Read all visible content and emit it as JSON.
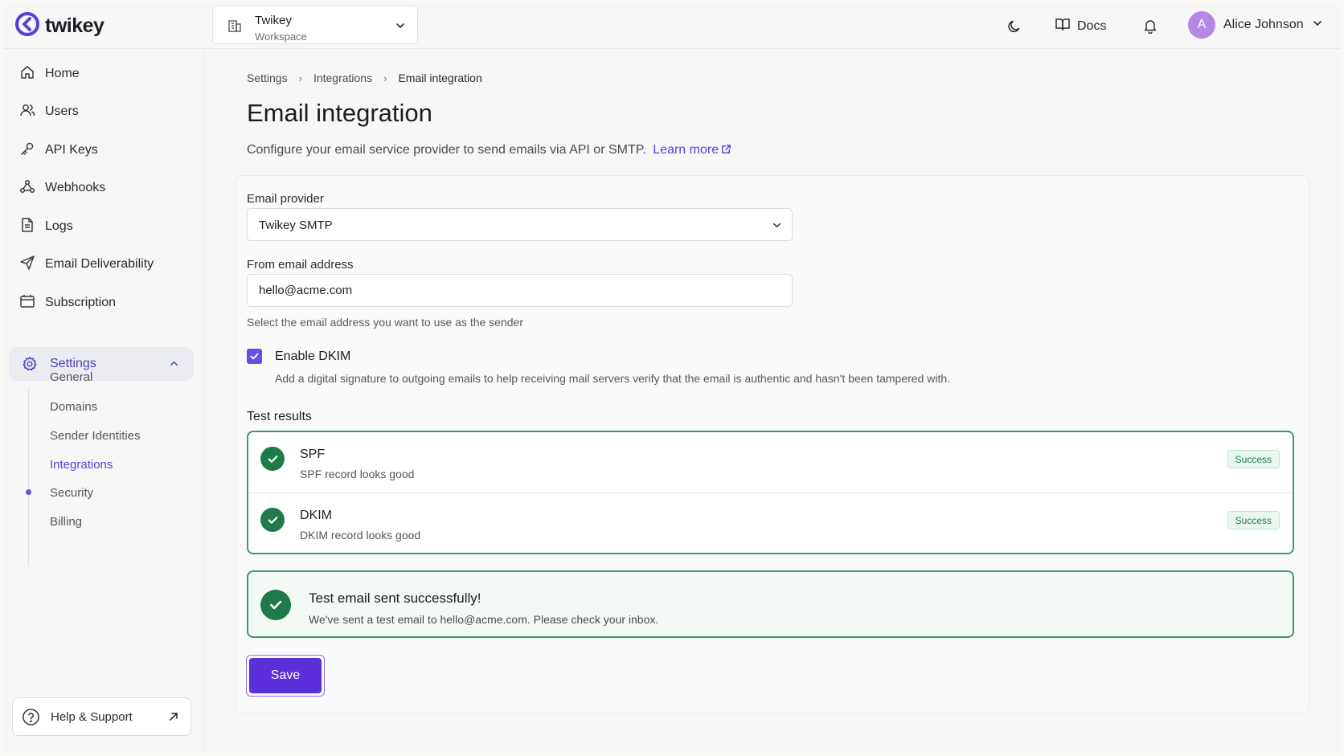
{
  "brand": {
    "name": "twikey",
    "accent": "#5b3ed6"
  },
  "workspace": {
    "name": "Twikey",
    "sub": "Workspace"
  },
  "header": {
    "docs_label": "Docs",
    "user_initial": "A",
    "user_name": "Alice Johnson"
  },
  "sidebar": {
    "items": [
      {
        "label": "Home",
        "icon": "home-icon"
      },
      {
        "label": "Users",
        "icon": "users-icon"
      },
      {
        "label": "API Keys",
        "icon": "key-icon"
      },
      {
        "label": "Webhooks",
        "icon": "webhook-icon"
      },
      {
        "label": "Logs",
        "icon": "document-icon"
      },
      {
        "label": "Email Deliverability",
        "icon": "send-icon"
      },
      {
        "label": "Subscription",
        "icon": "calendar-icon"
      }
    ],
    "settings": {
      "label": "Settings",
      "sub_items": [
        "General",
        "Domains",
        "Sender Identities",
        "Integrations",
        "Security",
        "Billing"
      ],
      "active": "Integrations"
    },
    "help_label": "Help & Support"
  },
  "breadcrumb": [
    "Settings",
    "Integrations",
    "Email integration"
  ],
  "page": {
    "title": "Email integration",
    "description": "Configure your email service provider to send emails via API or SMTP.",
    "learn_more": "Learn more"
  },
  "form": {
    "provider_label": "Email provider",
    "provider_value": "Twikey SMTP",
    "from_label": "From email address",
    "from_value": "hello@acme.com",
    "from_hint": "Select the email address you want to use as the sender",
    "dkim_label": "Enable DKIM",
    "dkim_checked": true,
    "dkim_desc": "Add a digital signature to outgoing emails to help receiving mail servers verify that the email is authentic and hasn't been tampered with.",
    "test_results_label": "Test results"
  },
  "tests": [
    {
      "name": "SPF",
      "detail": "SPF record looks good",
      "status": "Success"
    },
    {
      "name": "DKIM",
      "detail": "DKIM record looks good",
      "status": "Success"
    }
  ],
  "notice": {
    "title": "Test email sent successfully!",
    "text": "We've sent a test email to hello@acme.com. Please check your inbox."
  },
  "save_label": "Save",
  "colors": {
    "success": "#1f7a4a",
    "success_border": "#3e9a6b",
    "primary_button": "#5b2fd9"
  }
}
